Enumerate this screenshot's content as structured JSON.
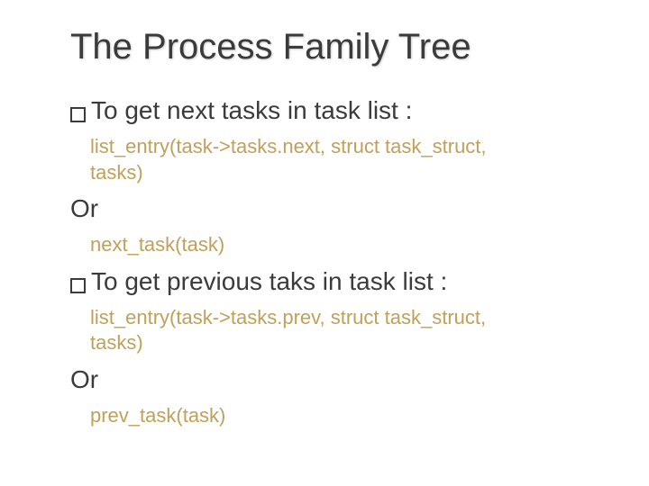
{
  "title": "The Process Family Tree",
  "section1": {
    "bullet": "To get next tasks in task list :",
    "code1_line1": "list_entry(task->tasks.next, struct task_struct,",
    "code1_line2": "tasks)",
    "or": "Or",
    "code2": "next_task(task)"
  },
  "section2": {
    "bullet": "To get previous taks in task list :",
    "code1_line1": " list_entry(task->tasks.prev, struct task_struct,",
    "code1_line2": "tasks)",
    "or": "Or",
    "code2": "prev_task(task)"
  }
}
